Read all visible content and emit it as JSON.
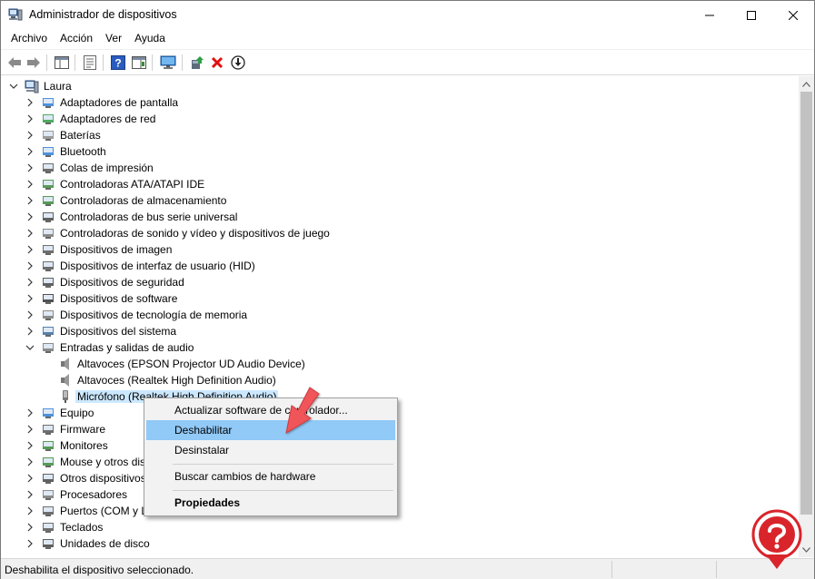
{
  "window": {
    "title": "Administrador de dispositivos"
  },
  "menu": [
    "Archivo",
    "Acción",
    "Ver",
    "Ayuda"
  ],
  "tree": {
    "root": "Laura",
    "items": [
      "Adaptadores de pantalla",
      "Adaptadores de red",
      "Baterías",
      "Bluetooth",
      "Colas de impresión",
      "Controladoras ATA/ATAPI IDE",
      "Controladoras de almacenamiento",
      "Controladoras de bus serie universal",
      "Controladoras de sonido y vídeo y dispositivos de juego",
      "Dispositivos de imagen",
      "Dispositivos de interfaz de usuario (HID)",
      "Dispositivos de seguridad",
      "Dispositivos de software",
      "Dispositivos de tecnología de memoria",
      "Dispositivos del sistema",
      "Entradas y salidas de audio"
    ],
    "audio_children": [
      "Altavoces (EPSON Projector UD Audio Device)",
      "Altavoces (Realtek High Definition Audio)",
      "Micrófono (Realtek High Definition Audio)"
    ],
    "items_after": [
      "Equipo",
      "Firmware",
      "Monitores",
      "Mouse y otros dis",
      "Otros dispositivos",
      "Procesadores",
      "Puertos (COM y L",
      "Teclados",
      "Unidades de disco"
    ]
  },
  "context_menu": {
    "update_driver": "Actualizar software de controlador...",
    "disable": "Deshabilitar",
    "uninstall": "Desinstalar",
    "scan": "Buscar cambios de hardware",
    "properties": "Propiedades"
  },
  "status": {
    "text": "Deshabilita el dispositivo seleccionado."
  },
  "colors": {
    "selection": "#cce8ff",
    "menu_highlight": "#91c9f7",
    "arrow": "#f0545a"
  },
  "icons": [
    "back-icon",
    "forward-icon",
    "properties-icon",
    "help-icon",
    "monitor-icon",
    "update-driver-icon",
    "uninstall-icon",
    "download-icon"
  ]
}
